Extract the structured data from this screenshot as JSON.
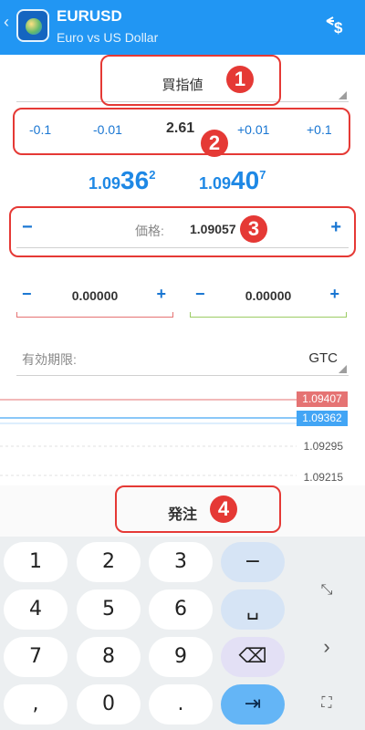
{
  "header": {
    "back": "‹",
    "symbol": "EURUSD",
    "description": "Euro vs US Dollar",
    "trade_icon": "$"
  },
  "order_type": "買指値",
  "volume": {
    "buttons": [
      "-0.1",
      "-0.01",
      "+0.01",
      "+0.1"
    ],
    "value": "2.61"
  },
  "prices": {
    "bid": {
      "small": "1.09",
      "big": "36",
      "sup": "2"
    },
    "ask": {
      "small": "1.09",
      "big": "40",
      "sup": "7"
    }
  },
  "price_field": {
    "minus": "−",
    "label": "価格:",
    "value": "1.09057",
    "plus": "+"
  },
  "stop_loss": {
    "minus": "−",
    "value": "0.00000",
    "plus": "+"
  },
  "take_profit": {
    "minus": "−",
    "value": "0.00000",
    "plus": "+"
  },
  "expiration": {
    "label": "有効期限:",
    "value": "GTC"
  },
  "chart": {
    "ask_tag": "1.09407",
    "bid_tag": "1.09362",
    "levels": [
      "1.09295",
      "1.09215"
    ],
    "colors": {
      "ask": "#e53935",
      "bid": "#42a5f5"
    }
  },
  "send_button": "発注",
  "keypad": {
    "digits": [
      "1",
      "2",
      "3",
      "4",
      "5",
      "6",
      "7",
      "8",
      "9",
      ",",
      "0",
      "."
    ],
    "minus": "−",
    "space": "␣",
    "delete": "⌫",
    "next": "⇥"
  },
  "side_icons": {
    "collapse": "⤡",
    "forward": "›",
    "resize": "⛶"
  },
  "annotations": [
    "1",
    "2",
    "3",
    "4"
  ]
}
